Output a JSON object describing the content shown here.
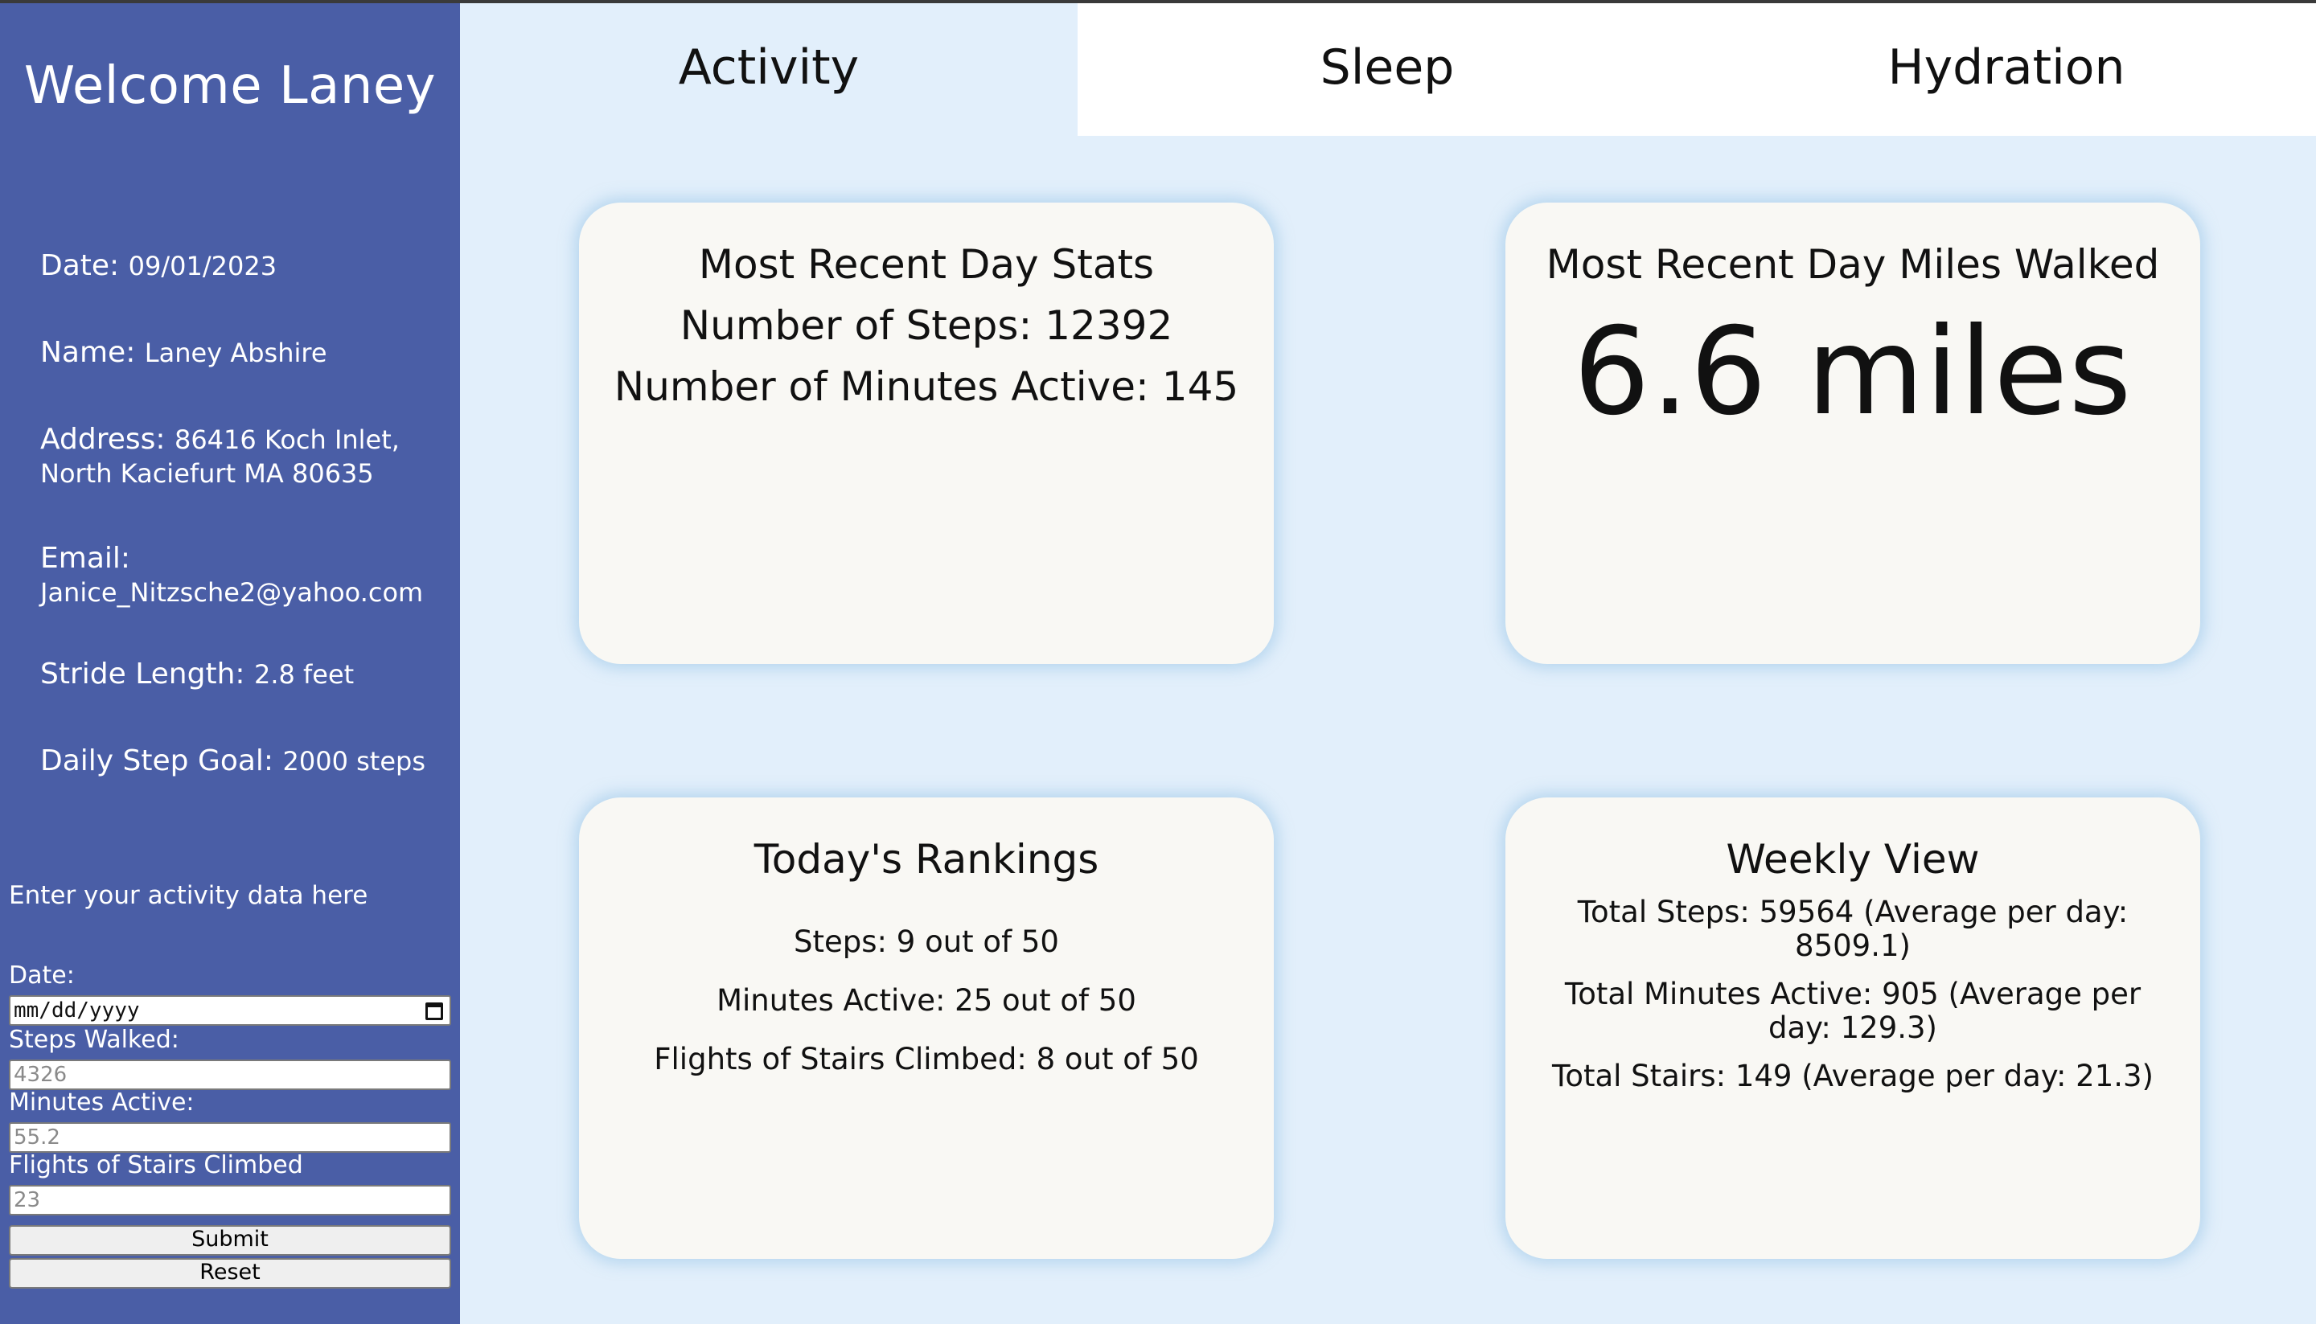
{
  "sidebar": {
    "welcome": "Welcome Laney",
    "date_label": "Date:",
    "date_value": "09/01/2023",
    "name_label": "Name:",
    "name_value": "Laney Abshire",
    "address_label": "Address:",
    "address_line1": "86416 Koch Inlet,",
    "address_line2": "North Kaciefurt MA 80635",
    "email_label": "Email:",
    "email_value": "Janice_Nitzsche2@yahoo.com",
    "stride_label": "Stride Length:",
    "stride_value": "2.8 feet",
    "goal_label": "Daily Step Goal:",
    "goal_value": "2000 steps"
  },
  "form": {
    "title": "Enter your activity data here",
    "date_label": "Date:",
    "date_placeholder": "mm/dd/yyyy",
    "steps_label": "Steps Walked:",
    "steps_placeholder": "4326",
    "minutes_label": "Minutes Active:",
    "minutes_placeholder": "55.2",
    "stairs_label": "Flights of Stairs Climbed",
    "stairs_placeholder": "23",
    "submit_label": "Submit",
    "reset_label": "Reset",
    "icons": {
      "date_picker": "calendar-icon"
    }
  },
  "tabs": [
    {
      "label": "Activity",
      "active": true
    },
    {
      "label": "Sleep",
      "active": false
    },
    {
      "label": "Hydration",
      "active": false
    }
  ],
  "cards": {
    "recent": {
      "title": "Most Recent Day Stats",
      "steps": "Number of Steps: 12392",
      "minutes": "Number of Minutes Active: 145"
    },
    "miles": {
      "title": "Most Recent Day Miles Walked",
      "value": "6.6 miles"
    },
    "rankings": {
      "title": "Today's Rankings",
      "steps": "Steps: 9 out of 50",
      "minutes": "Minutes Active: 25 out of 50",
      "stairs": "Flights of Stairs Climbed: 8 out of 50"
    },
    "weekly": {
      "title": "Weekly View",
      "steps": "Total Steps: 59564 (Average per day: 8509.1)",
      "minutes": "Total Minutes Active: 905 (Average per day: 129.3)",
      "stairs": "Total Stairs: 149 (Average per day: 21.3)"
    }
  },
  "colors": {
    "sidebar": "#4a5ea6",
    "background": "#e2effb",
    "card": "#f9f8f4"
  }
}
